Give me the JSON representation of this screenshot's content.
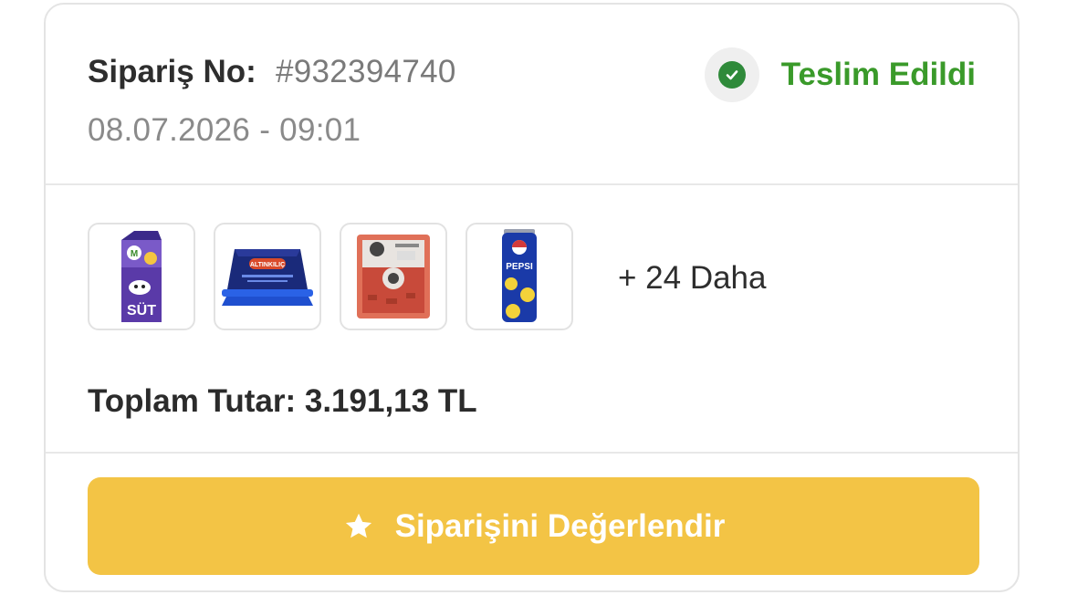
{
  "order": {
    "label": "Sipariş No:",
    "number": "#932394740",
    "datetime": "08.07.2026 - 09:01",
    "status": "Teslim Edildi",
    "status_icon": "check-circle-icon",
    "status_color": "#3a9a2a"
  },
  "products": [
    {
      "name": "süt",
      "icon": "milk-carton"
    },
    {
      "name": "altınkılıç peynir",
      "icon": "cheese-tub"
    },
    {
      "name": "kıyma",
      "icon": "minced-meat-pack"
    },
    {
      "name": "pepsi",
      "icon": "soda-can"
    }
  ],
  "more_text": "+ 24 Daha",
  "total_text": "Toplam Tutar: 3.191,13 TL",
  "rate_button": {
    "label": "Siparişini Değerlendir",
    "icon": "star-icon",
    "color": "#f3c445"
  },
  "product_texts": {
    "milk_word": "SÜT",
    "cheese_brand": "ALTINKILIÇ",
    "pepsi_word": "PEPSI"
  }
}
